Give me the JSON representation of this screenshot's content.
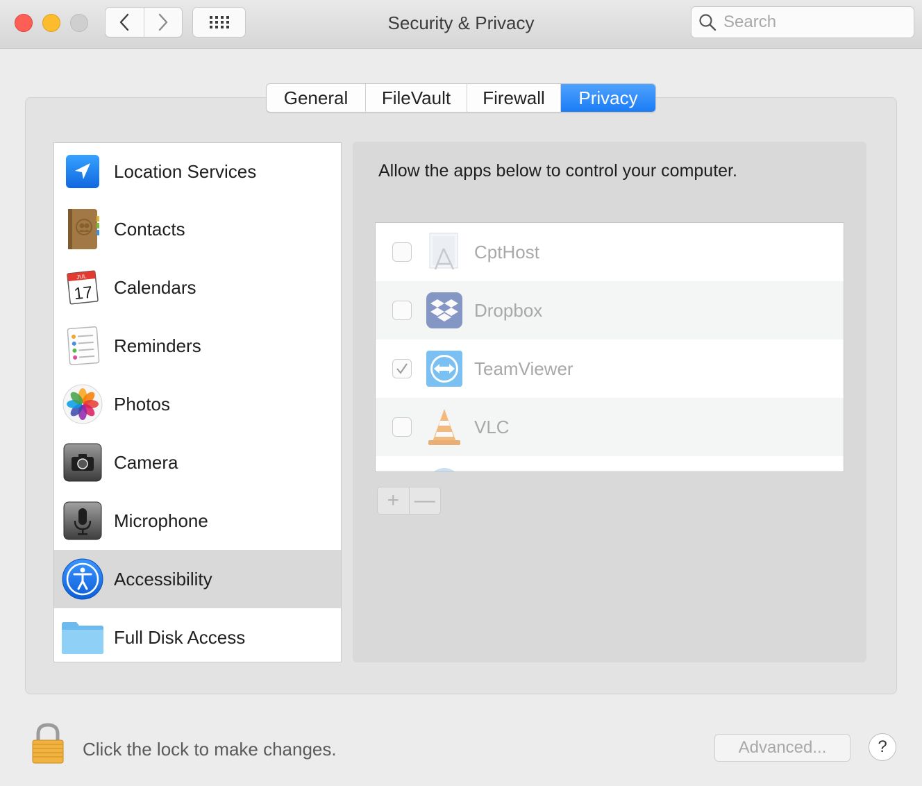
{
  "window": {
    "title": "Security & Privacy",
    "search_placeholder": "Search"
  },
  "tabs": [
    {
      "label": "General",
      "active": false
    },
    {
      "label": "FileVault",
      "active": false
    },
    {
      "label": "Firewall",
      "active": false
    },
    {
      "label": "Privacy",
      "active": true
    }
  ],
  "categories": [
    {
      "label": "Location Services",
      "icon": "location-arrow-icon"
    },
    {
      "label": "Contacts",
      "icon": "contacts-book-icon"
    },
    {
      "label": "Calendars",
      "icon": "calendar-icon",
      "icon_month": "JUL",
      "icon_day": "17"
    },
    {
      "label": "Reminders",
      "icon": "reminders-icon"
    },
    {
      "label": "Photos",
      "icon": "photos-flower-icon"
    },
    {
      "label": "Camera",
      "icon": "camera-icon"
    },
    {
      "label": "Microphone",
      "icon": "microphone-icon"
    },
    {
      "label": "Accessibility",
      "icon": "accessibility-icon",
      "selected": true
    },
    {
      "label": "Full Disk Access",
      "icon": "folder-icon"
    }
  ],
  "detail": {
    "heading": "Allow the apps below to control your computer.",
    "apps": [
      {
        "name": "CptHost",
        "checked": false,
        "icon": "app-generic-icon"
      },
      {
        "name": "Dropbox",
        "checked": false,
        "icon": "dropbox-icon"
      },
      {
        "name": "TeamViewer",
        "checked": true,
        "icon": "teamviewer-icon"
      },
      {
        "name": "VLC",
        "checked": false,
        "icon": "vlc-cone-icon"
      }
    ],
    "add_symbol": "+",
    "remove_symbol": "—"
  },
  "footer": {
    "lock_text": "Click the lock to make changes.",
    "advanced_label": "Advanced...",
    "help_label": "?"
  },
  "colors": {
    "accent": "#1a7cf5",
    "selected_row": "#d9d9d9"
  }
}
